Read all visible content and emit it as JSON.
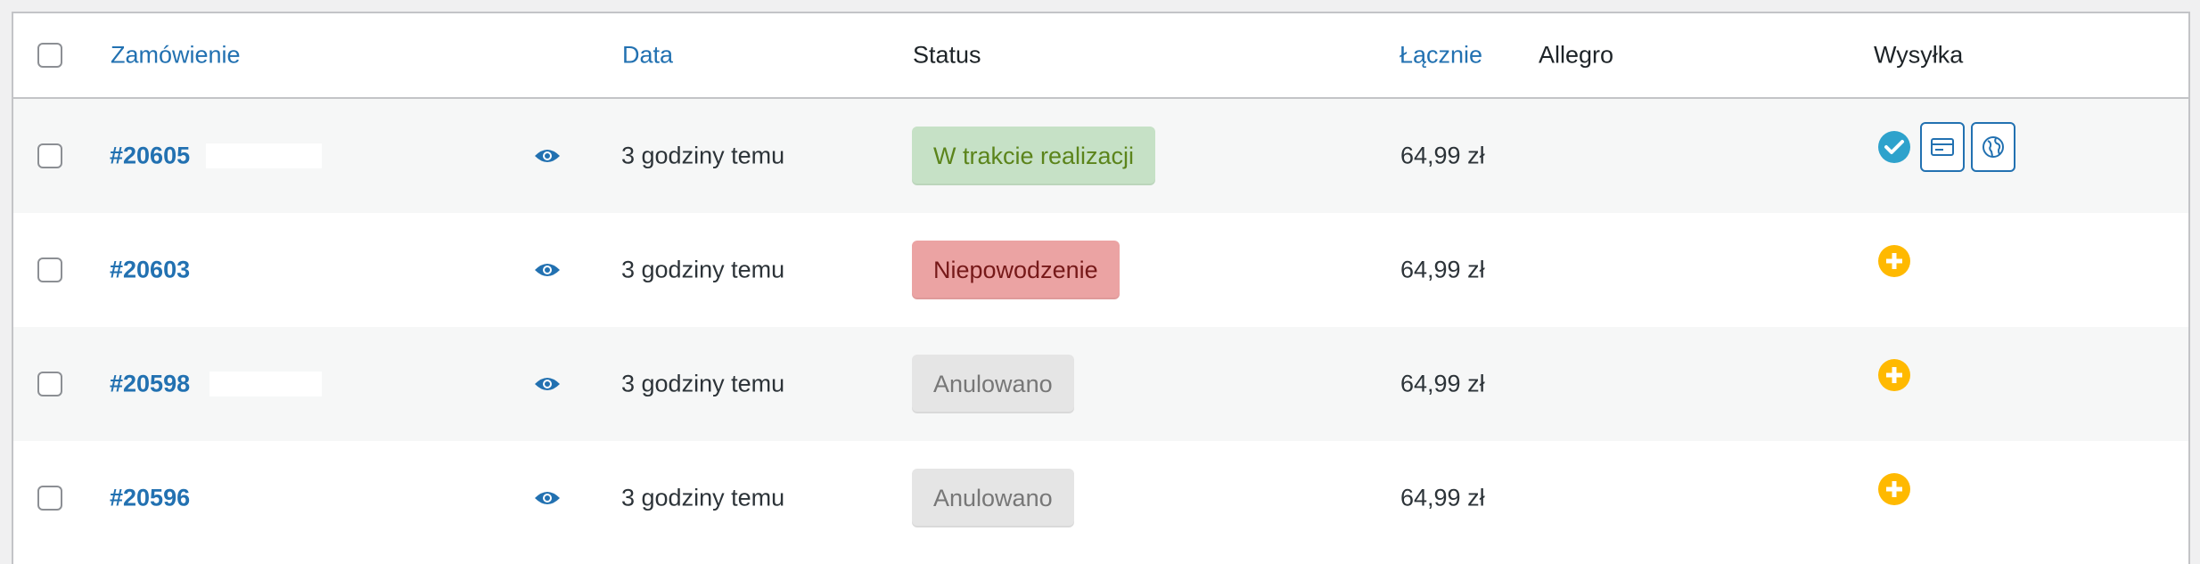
{
  "header": {
    "order": "Zamówienie",
    "date": "Data",
    "status": "Status",
    "total": "Łącznie",
    "allegro": "Allegro",
    "shipping": "Wysyłka"
  },
  "colors": {
    "link": "#2271b1",
    "processing_bg": "#c6e1c6",
    "failed_bg": "#eba3a3",
    "cancelled_bg": "#e5e5e5",
    "check_icon": "#2ea2cc",
    "add_icon": "#ffb900"
  },
  "rows": [
    {
      "order": "#20605",
      "date": "3 godziny temu",
      "status": "W trakcie realizacji",
      "total": "64,99 zł",
      "allegro": "",
      "shipping_icons": [
        "check-circle-icon",
        "label-icon",
        "globe-icon"
      ]
    },
    {
      "order": "#20603",
      "date": "3 godziny temu",
      "status": "Niepowodzenie",
      "total": "64,99 zł",
      "allegro": "",
      "shipping_icons": [
        "add-circle-icon"
      ]
    },
    {
      "order": "#20598",
      "date": "3 godziny temu",
      "status": "Anulowano",
      "total": "64,99 zł",
      "allegro": "",
      "shipping_icons": [
        "add-circle-icon"
      ]
    },
    {
      "order": "#20596",
      "date": "3 godziny temu",
      "status": "Anulowano",
      "total": "64,99 zł",
      "allegro": "",
      "shipping_icons": [
        "add-circle-icon"
      ]
    }
  ]
}
